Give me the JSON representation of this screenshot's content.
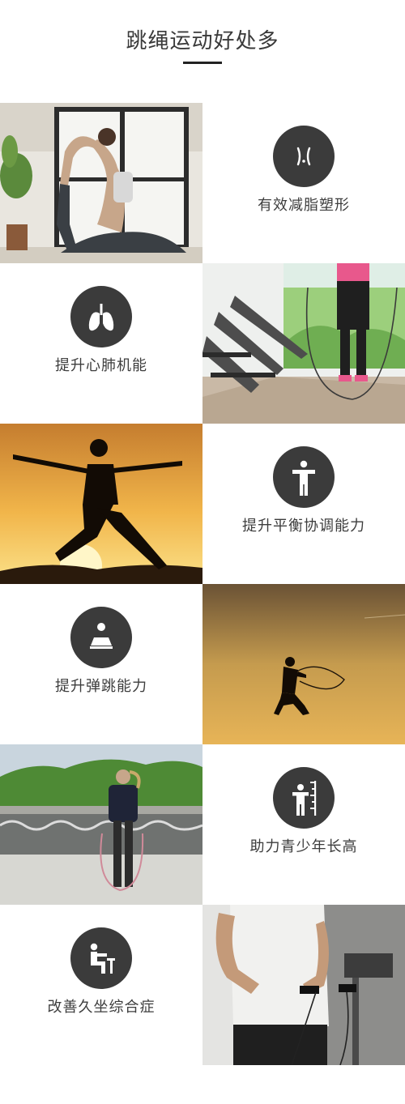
{
  "header": {
    "title": "跳绳运动好处多"
  },
  "benefits": [
    {
      "label": "有效减脂塑形",
      "icon": "body-curve-icon"
    },
    {
      "label": "提升心肺机能",
      "icon": "lungs-icon"
    },
    {
      "label": "提升平衡协调能力",
      "icon": "person-balance-icon"
    },
    {
      "label": "提升弹跳能力",
      "icon": "jump-platform-icon"
    },
    {
      "label": "助力青少年长高",
      "icon": "height-ruler-icon"
    },
    {
      "label": "改善久坐综合症",
      "icon": "sitting-person-icon"
    }
  ],
  "photos": [
    "yoga-photo",
    "gym-rope-photo",
    "sunset-pose-photo",
    "jumping-silhouette-photo",
    "outdoor-rope-photo",
    "man-rope-photo"
  ],
  "colors": {
    "icon_bg": "#3b3b3b",
    "text": "#3d3d3d",
    "rule": "#222222"
  }
}
